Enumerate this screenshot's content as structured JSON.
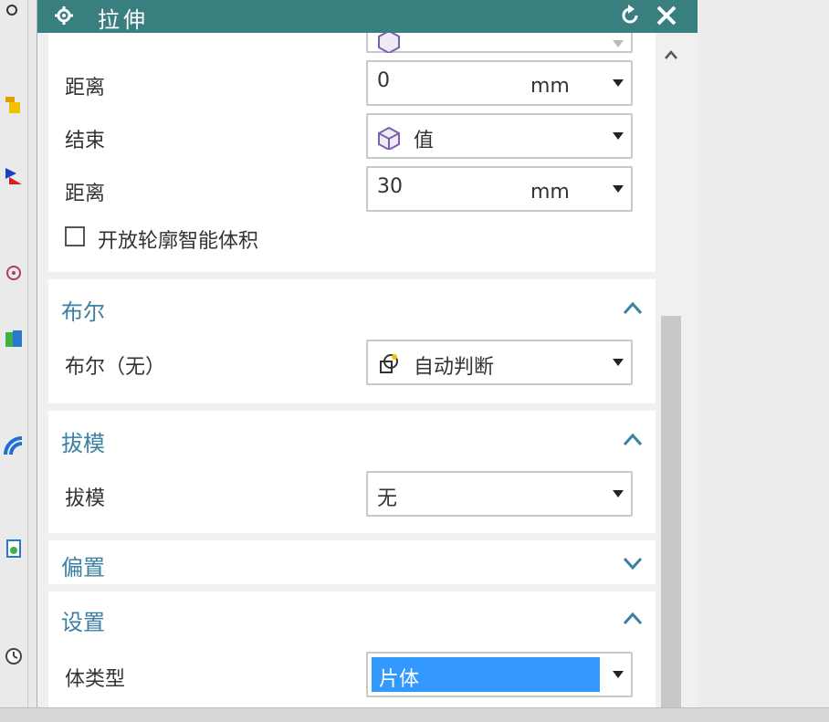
{
  "dialog": {
    "title": "拉伸",
    "icons": {
      "gear": "gear-icon",
      "reset": "reset-icon",
      "close": "close-icon"
    }
  },
  "limits": {
    "partial_row_label": "",
    "start_distance_label": "距离",
    "start_distance_value": "0",
    "start_distance_unit": "mm",
    "end_label": "结束",
    "end_value": "值",
    "end_distance_label": "距离",
    "end_distance_value": "30",
    "end_distance_unit": "mm",
    "open_profile_checkbox_label": "开放轮廓智能体积"
  },
  "boolean": {
    "title": "布尔",
    "row_label": "布尔（无）",
    "value": "自动判断"
  },
  "draft": {
    "title": "拔模",
    "row_label": "拔模",
    "value": "无"
  },
  "offset": {
    "title": "偏置"
  },
  "settings": {
    "title": "设置",
    "body_type_label": "体类型",
    "body_type_value": "片体"
  },
  "colors": {
    "titlebar": "#3a7f7f",
    "section_title": "#3a80a3",
    "selection": "#3399ff"
  }
}
